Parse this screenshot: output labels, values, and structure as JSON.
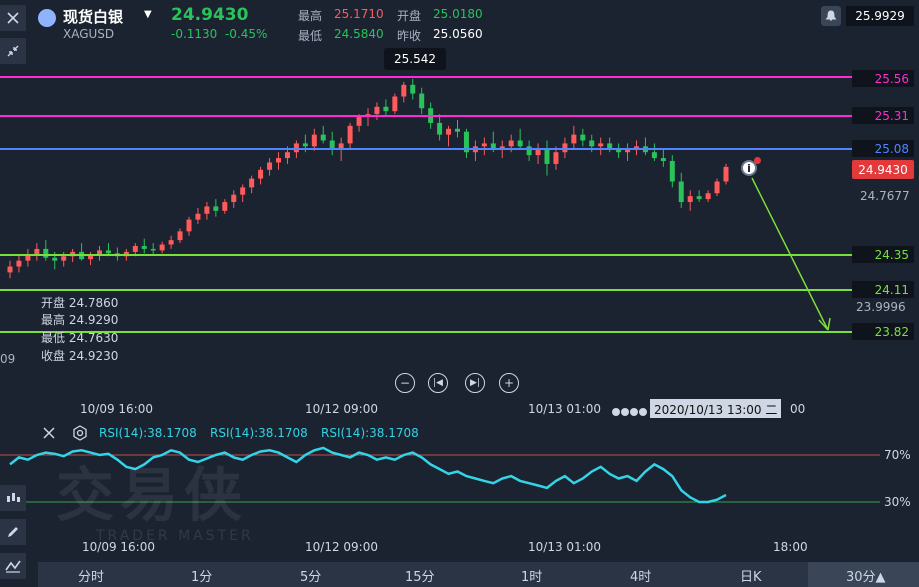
{
  "header": {
    "symbol_name": "现货白银",
    "symbol_code": "XAGUSD",
    "price": "24.9430",
    "change_abs": "-0.1130",
    "change_pct": "-0.45%",
    "high_label": "最高",
    "high_value": "25.1710",
    "open_label": "开盘",
    "open_value": "25.0180",
    "low_label": "最低",
    "low_value": "24.5840",
    "prev_close_label": "昨收",
    "prev_close_value": "25.0560",
    "top_right_price": "25.9929"
  },
  "price_lines": [
    {
      "label": "25.56",
      "color": "#ff2bd6"
    },
    {
      "label": "25.31",
      "color": "#ff2bd6"
    },
    {
      "label": "25.08",
      "color": "#4f86ff"
    },
    {
      "label": "24.35",
      "color": "#79e03a"
    },
    {
      "label": "24.11",
      "color": "#79e03a"
    },
    {
      "label": "23.82",
      "color": "#79e03a"
    }
  ],
  "price_axis": {
    "current": "24.9430",
    "level1": "24.7677",
    "level2": "23.9996"
  },
  "peak_label": "25.542",
  "left_cut_label": "09",
  "ohlc_box": {
    "open": "开盘 24.7860",
    "high": "最高 24.9290",
    "low": "最低 24.7630",
    "close": "收盘 24.9230"
  },
  "time_axis": {
    "t1": "10/09 16:00",
    "t2": "10/12 09:00",
    "t3": "10/13 01:00",
    "crosshair": "2020/10/13 13:00",
    "crosshair_day": "二",
    "t4_tail": "00",
    "b1": "10/09 16:00",
    "b2": "10/12 09:00",
    "b3": "10/13 01:00",
    "b4": "18:00"
  },
  "rsi": {
    "labels": [
      "RSI(14):38.1708",
      "RSI(14):38.1708",
      "RSI(14):38.1708"
    ],
    "level_high": "70%",
    "level_low": "30%"
  },
  "timeframes": [
    "分时",
    "1分",
    "5分",
    "15分",
    "1时",
    "4时",
    "日K",
    "30分▲"
  ],
  "watermark": {
    "cn": "交易侠",
    "en": "TRADER MASTER"
  },
  "candles": [
    [
      24.22,
      24.3,
      24.18,
      24.26
    ],
    [
      24.26,
      24.34,
      24.22,
      24.3
    ],
    [
      24.3,
      24.38,
      24.26,
      24.34
    ],
    [
      24.34,
      24.42,
      24.3,
      24.38
    ],
    [
      24.38,
      24.44,
      24.3,
      24.32
    ],
    [
      24.32,
      24.36,
      24.24,
      24.3
    ],
    [
      24.3,
      24.36,
      24.26,
      24.33
    ],
    [
      24.33,
      24.38,
      24.29,
      24.36
    ],
    [
      24.36,
      24.42,
      24.3,
      24.31
    ],
    [
      24.31,
      24.36,
      24.27,
      24.34
    ],
    [
      24.34,
      24.4,
      24.3,
      24.37
    ],
    [
      24.37,
      24.42,
      24.33,
      24.35
    ],
    [
      24.35,
      24.39,
      24.3,
      24.33
    ],
    [
      24.33,
      24.38,
      24.3,
      24.36
    ],
    [
      24.36,
      24.42,
      24.33,
      24.4
    ],
    [
      24.4,
      24.45,
      24.35,
      24.38
    ],
    [
      24.38,
      24.42,
      24.34,
      24.37
    ],
    [
      24.37,
      24.43,
      24.35,
      24.41
    ],
    [
      24.41,
      24.47,
      24.38,
      24.44
    ],
    [
      24.44,
      24.52,
      24.42,
      24.5
    ],
    [
      24.5,
      24.6,
      24.47,
      24.58
    ],
    [
      24.58,
      24.66,
      24.55,
      24.62
    ],
    [
      24.62,
      24.7,
      24.58,
      24.67
    ],
    [
      24.67,
      24.72,
      24.6,
      24.64
    ],
    [
      24.64,
      24.72,
      24.62,
      24.7
    ],
    [
      24.7,
      24.78,
      24.66,
      24.75
    ],
    [
      24.75,
      24.82,
      24.7,
      24.8
    ],
    [
      24.8,
      24.88,
      24.76,
      24.86
    ],
    [
      24.86,
      24.94,
      24.82,
      24.92
    ],
    [
      24.92,
      25.0,
      24.88,
      24.97
    ],
    [
      24.97,
      25.04,
      24.92,
      25.0
    ],
    [
      25.0,
      25.08,
      24.96,
      25.04
    ],
    [
      25.04,
      25.12,
      25.0,
      25.1
    ],
    [
      25.1,
      25.16,
      25.04,
      25.08
    ],
    [
      25.08,
      25.2,
      25.05,
      25.16
    ],
    [
      25.16,
      25.22,
      25.1,
      25.12
    ],
    [
      25.12,
      25.18,
      25.02,
      25.06
    ],
    [
      25.06,
      25.14,
      24.98,
      25.1
    ],
    [
      25.1,
      25.24,
      25.06,
      25.22
    ],
    [
      25.22,
      25.3,
      25.18,
      25.28
    ],
    [
      25.28,
      25.34,
      25.22,
      25.3
    ],
    [
      25.3,
      25.38,
      25.26,
      25.35
    ],
    [
      25.35,
      25.4,
      25.28,
      25.32
    ],
    [
      25.32,
      25.44,
      25.3,
      25.42
    ],
    [
      25.42,
      25.52,
      25.38,
      25.5
    ],
    [
      25.5,
      25.54,
      25.4,
      25.44
    ],
    [
      25.44,
      25.48,
      25.3,
      25.34
    ],
    [
      25.34,
      25.38,
      25.2,
      25.24
    ],
    [
      25.24,
      25.3,
      25.12,
      25.16
    ],
    [
      25.16,
      25.22,
      25.08,
      25.2
    ],
    [
      25.2,
      25.26,
      25.14,
      25.18
    ],
    [
      25.18,
      25.2,
      25.0,
      25.04
    ],
    [
      25.04,
      25.12,
      24.98,
      25.08
    ],
    [
      25.08,
      25.14,
      25.02,
      25.1
    ],
    [
      25.1,
      25.18,
      25.04,
      25.06
    ],
    [
      25.06,
      25.12,
      25.0,
      25.08
    ],
    [
      25.08,
      25.16,
      25.04,
      25.12
    ],
    [
      25.12,
      25.2,
      25.06,
      25.08
    ],
    [
      25.08,
      25.12,
      24.98,
      25.02
    ],
    [
      25.02,
      25.1,
      24.96,
      25.06
    ],
    [
      25.06,
      25.12,
      24.88,
      24.96
    ],
    [
      24.96,
      25.08,
      24.92,
      25.04
    ],
    [
      25.04,
      25.14,
      25.0,
      25.1
    ],
    [
      25.1,
      25.22,
      25.06,
      25.16
    ],
    [
      25.16,
      25.2,
      25.08,
      25.12
    ],
    [
      25.12,
      25.16,
      25.04,
      25.08
    ],
    [
      25.08,
      25.14,
      25.02,
      25.1
    ],
    [
      25.1,
      25.14,
      25.04,
      25.06
    ],
    [
      25.06,
      25.1,
      25.0,
      25.04
    ],
    [
      25.04,
      25.1,
      24.98,
      25.06
    ],
    [
      25.06,
      25.12,
      25.02,
      25.08
    ],
    [
      25.08,
      25.14,
      25.02,
      25.04
    ],
    [
      25.04,
      25.1,
      24.98,
      25.0
    ],
    [
      25.0,
      25.06,
      24.94,
      24.98
    ],
    [
      24.98,
      25.02,
      24.8,
      24.84
    ],
    [
      24.84,
      24.9,
      24.66,
      24.7
    ],
    [
      24.7,
      24.78,
      24.64,
      24.74
    ],
    [
      24.74,
      24.78,
      24.7,
      24.72
    ],
    [
      24.72,
      24.78,
      24.7,
      24.76
    ],
    [
      24.76,
      24.86,
      24.74,
      24.84
    ],
    [
      24.84,
      24.96,
      24.82,
      24.94
    ]
  ],
  "rsi_series": [
    62,
    68,
    66,
    70,
    72,
    71,
    69,
    73,
    74,
    72,
    70,
    71,
    66,
    60,
    58,
    62,
    68,
    70,
    74,
    72,
    66,
    64,
    67,
    70,
    72,
    68,
    66,
    70,
    73,
    74,
    72,
    68,
    64,
    70,
    74,
    76,
    72,
    70,
    68,
    72,
    70,
    66,
    68,
    66,
    70,
    72,
    68,
    62,
    58,
    54,
    56,
    52,
    50,
    48,
    46,
    50,
    52,
    48,
    46,
    44,
    42,
    48,
    52,
    46,
    50,
    56,
    60,
    54,
    50,
    52,
    48,
    56,
    62,
    58,
    52,
    40,
    34,
    30,
    30,
    32,
    36
  ]
}
